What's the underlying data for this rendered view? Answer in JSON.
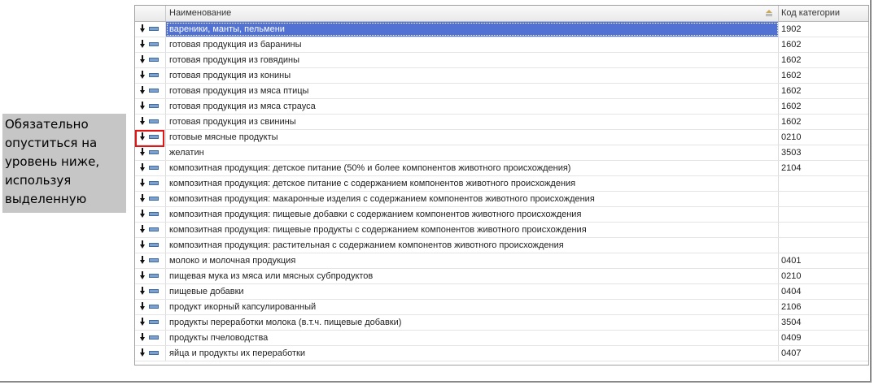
{
  "note": {
    "lines": [
      "Обязательно",
      "опуститься на",
      "уровень ниже,",
      "используя",
      "выделенную"
    ]
  },
  "header": {
    "name": "Наименование",
    "code": "Код категории"
  },
  "rows": [
    {
      "name": "вареники, манты, пельмени",
      "code": "1902",
      "selected": true
    },
    {
      "name": "готовая продукция из баранины",
      "code": "1602"
    },
    {
      "name": "готовая продукция из говядины",
      "code": "1602"
    },
    {
      "name": "готовая продукция из конины",
      "code": "1602"
    },
    {
      "name": "готовая продукция из мяса птицы",
      "code": "1602"
    },
    {
      "name": "готовая продукция из мяса страуса",
      "code": "1602"
    },
    {
      "name": "готовая продукция из свинины",
      "code": "1602"
    },
    {
      "name": "готовые мясные продукты",
      "code": "0210",
      "highlighted": true
    },
    {
      "name": "желатин",
      "code": "3503"
    },
    {
      "name": "композитная продукция: детское питание (50% и более компонентов животного происхождения)",
      "code": "2104"
    },
    {
      "name": "композитная продукция: детское питание с содержанием компонентов животного происхождения",
      "code": ""
    },
    {
      "name": "композитная продукция: макаронные изделия с содержанием компонентов животного происхождения",
      "code": ""
    },
    {
      "name": "композитная продукция: пищевые добавки с содержанием компонентов животного происхождения",
      "code": ""
    },
    {
      "name": "композитная продукция: пищевые продукты с содержанием компонентов животного происхождения",
      "code": ""
    },
    {
      "name": "композитная продукция: растительная с содержанием компонентов животного происхождения",
      "code": ""
    },
    {
      "name": "молоко и молочная продукция",
      "code": "0401"
    },
    {
      "name": "пищевая мука из мяса или мясных субпродуктов",
      "code": "0210"
    },
    {
      "name": "пищевые добавки",
      "code": "0404"
    },
    {
      "name": "продукт икорный капсулированный",
      "code": "2106"
    },
    {
      "name": "продукты переработки молока (в.т.ч. пищевые добавки)",
      "code": "3504"
    },
    {
      "name": "продукты пчеловодства",
      "code": "0409"
    },
    {
      "name": "яйца и продукты их переработки",
      "code": "0407"
    }
  ],
  "colors": {
    "selection": "#5272d3",
    "highlight_box": "#e01515",
    "note_background": "#c6c6c6"
  }
}
